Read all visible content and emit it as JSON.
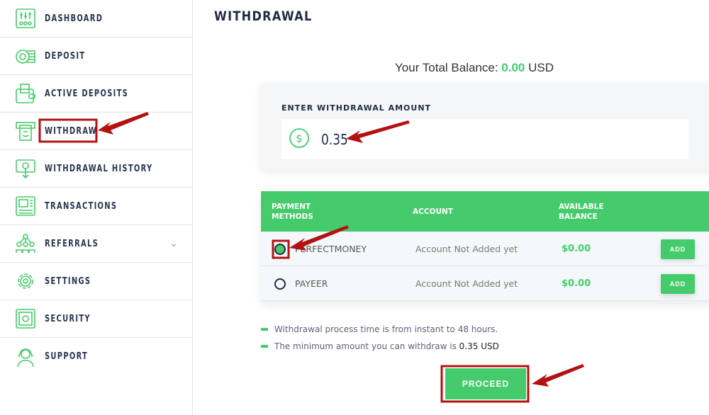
{
  "sidebar": {
    "items": [
      {
        "label": "DASHBOARD",
        "icon": "sliders-icon"
      },
      {
        "label": "DEPOSIT",
        "icon": "coins-icon"
      },
      {
        "label": "ACTIVE DEPOSITS",
        "icon": "wallet-icon"
      },
      {
        "label": "WITHDRAW",
        "icon": "atm-cash-icon",
        "active": true
      },
      {
        "label": "WITHDRAWAL HISTORY",
        "icon": "cash-download-icon"
      },
      {
        "label": "TRANSACTIONS",
        "icon": "receipt-icon"
      },
      {
        "label": "REFERRALS",
        "icon": "network-icon",
        "has_submenu": true
      },
      {
        "label": "SETTINGS",
        "icon": "gear-icon"
      },
      {
        "label": "SECURITY",
        "icon": "safe-icon"
      },
      {
        "label": "SUPPORT",
        "icon": "headset-icon"
      }
    ]
  },
  "page": {
    "title": "WITHDRAWAL",
    "balance_label": "Your Total Balance:",
    "balance_value": "0.00",
    "balance_currency": "USD",
    "amount_label": "ENTER WITHDRAWAL AMOUNT",
    "amount_value": "0.35",
    "table": {
      "headers": {
        "method_1": "PAYMENT",
        "method_2": "METHODS",
        "account": "ACCOUNT",
        "balance_1": "AVAILABLE",
        "balance_2": "BALANCE"
      },
      "rows": [
        {
          "method": "PERFECTMONEY",
          "account": "Account Not Added yet",
          "balance": "$0.00",
          "action": "ADD",
          "selected": true
        },
        {
          "method": "PAYEER",
          "account": "Account Not Added yet",
          "balance": "$0.00",
          "action": "ADD",
          "selected": false
        }
      ]
    },
    "notes": [
      "Withdrawal process time is from instant to 48 hours.",
      "The minimum amount you can withdraw is"
    ],
    "min_amount": "0.35 USD",
    "proceed_label": "PROCEED"
  },
  "colors": {
    "accent": "#46cb6c",
    "annotation": "#b31212",
    "text": "#1f2a44"
  }
}
